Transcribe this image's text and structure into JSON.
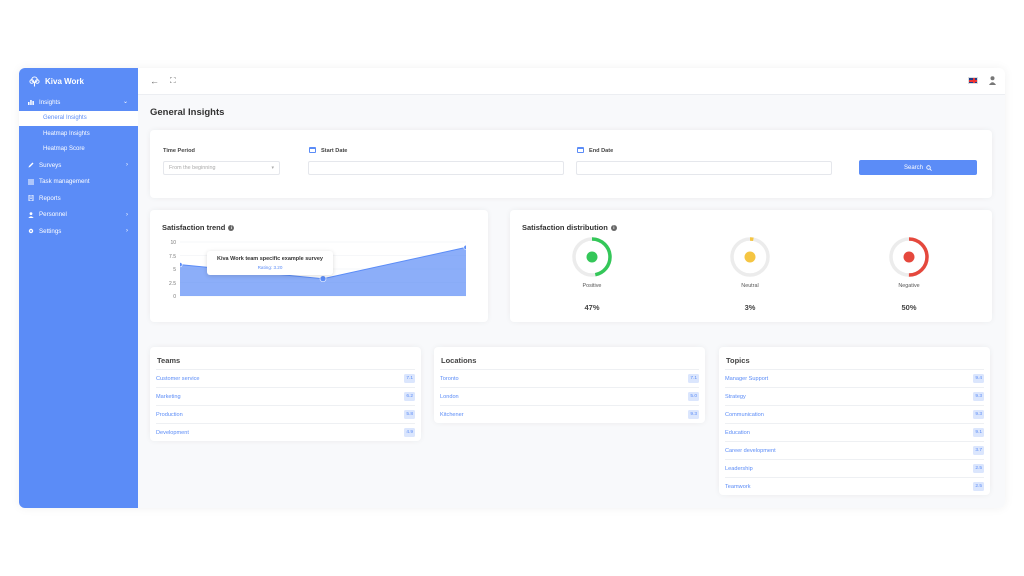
{
  "app": {
    "name": "Kiva Work"
  },
  "sidebar": {
    "items": [
      {
        "label": "Insights",
        "icon": "bar-chart-icon",
        "chevron": "⌄"
      },
      {
        "label": "Surveys",
        "icon": "pencil-icon",
        "chevron": "›"
      },
      {
        "label": "Task management",
        "icon": "list-icon"
      },
      {
        "label": "Reports",
        "icon": "document-icon"
      },
      {
        "label": "Personnel",
        "icon": "person-icon",
        "chevron": "›"
      },
      {
        "label": "Settings",
        "icon": "gear-icon",
        "chevron": "›"
      }
    ],
    "sub_items": [
      {
        "label": "General Insights",
        "active": true
      },
      {
        "label": "Heatmap Insights"
      },
      {
        "label": "Heatmap Score"
      }
    ]
  },
  "topbar": {
    "back_icon": "←",
    "fullscreen_icon": "⛶",
    "language": "UK flag"
  },
  "page": {
    "title": "General Insights"
  },
  "filters": {
    "time_period_label": "Time Period",
    "time_period_value": "From the beginning",
    "start_date_label": "Start Date",
    "end_date_label": "End Date",
    "search_label": "Search"
  },
  "trend": {
    "title": "Satisfaction trend",
    "tooltip_title": "Kiva Work team specific example survey",
    "tooltip_value": "Rating: 3.20"
  },
  "chart_data": {
    "type": "area",
    "x": [
      0,
      1,
      2
    ],
    "values": [
      5.8,
      3.2,
      9.0
    ],
    "ylim": [
      0,
      10
    ],
    "yticks": [
      "10",
      "7.5",
      "5",
      "2.5",
      "0"
    ],
    "color": "#5b8cf7"
  },
  "distribution": {
    "title": "Satisfaction distribution",
    "items": [
      {
        "label": "Positive",
        "pct": "47%",
        "value": 0.47,
        "color": "#34c759",
        "face": "😊"
      },
      {
        "label": "Neutral",
        "pct": "3%",
        "value": 0.03,
        "color": "#f5c542",
        "face": "😐"
      },
      {
        "label": "Negative",
        "pct": "50%",
        "value": 0.5,
        "color": "#e5483d",
        "face": "☹"
      }
    ]
  },
  "teams": {
    "title": "Teams",
    "rows": [
      {
        "name": "Customer service",
        "score": "7.1"
      },
      {
        "name": "Marketing",
        "score": "6.2"
      },
      {
        "name": "Production",
        "score": "5.8"
      },
      {
        "name": "Development",
        "score": "4.9"
      }
    ]
  },
  "locations": {
    "title": "Locations",
    "rows": [
      {
        "name": "Toronto",
        "score": "7.1"
      },
      {
        "name": "London",
        "score": "5.0"
      },
      {
        "name": "Kitchener",
        "score": "9.3"
      }
    ]
  },
  "topics": {
    "title": "Topics",
    "rows": [
      {
        "name": "Manager Support",
        "score": "9.4"
      },
      {
        "name": "Strategy",
        "score": "9.3"
      },
      {
        "name": "Communication",
        "score": "9.3"
      },
      {
        "name": "Education",
        "score": "9.1"
      },
      {
        "name": "Career development",
        "score": "3.7"
      },
      {
        "name": "Leadership",
        "score": "2.5"
      },
      {
        "name": "Teamwork",
        "score": "2.5"
      }
    ]
  }
}
